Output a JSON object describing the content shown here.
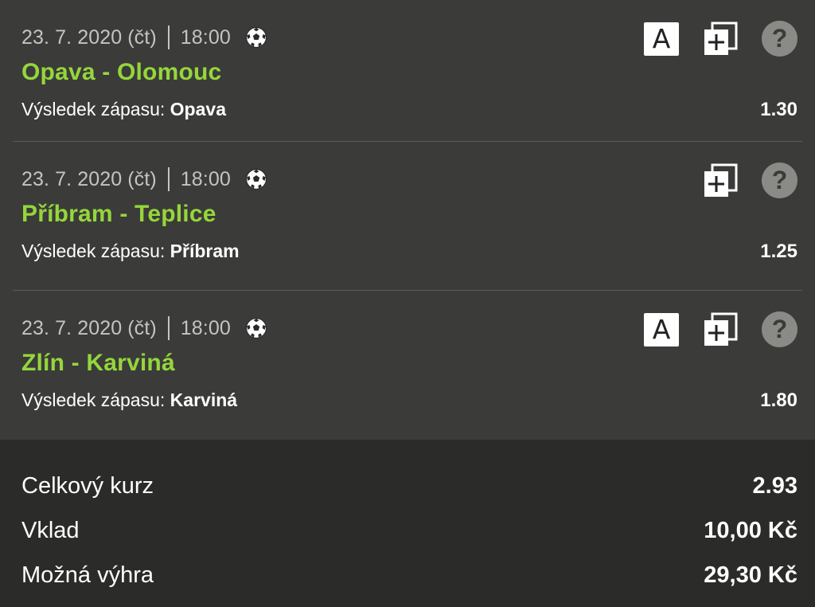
{
  "matches": [
    {
      "date": "23. 7. 2020 (čt)",
      "time": "18:00",
      "sport_icon": "soccer-ball-icon",
      "teams": "Opava - Olomouc",
      "outcome_label": "Výsledek zápasu:",
      "outcome_value": "Opava",
      "odd": "1.30",
      "has_a_button": true,
      "a_label": "A",
      "help_label": "?"
    },
    {
      "date": "23. 7. 2020 (čt)",
      "time": "18:00",
      "sport_icon": "soccer-ball-icon",
      "teams": "Příbram - Teplice",
      "outcome_label": "Výsledek zápasu:",
      "outcome_value": "Příbram",
      "odd": "1.25",
      "has_a_button": false,
      "help_label": "?"
    },
    {
      "date": "23. 7. 2020 (čt)",
      "time": "18:00",
      "sport_icon": "soccer-ball-icon",
      "teams": "Zlín - Karviná",
      "outcome_label": "Výsledek zápasu:",
      "outcome_value": "Karviná",
      "odd": "1.80",
      "has_a_button": true,
      "a_label": "A",
      "help_label": "?"
    }
  ],
  "summary": {
    "total_odds_label": "Celkový kurz",
    "total_odds_value": "2.93",
    "stake_label": "Vklad",
    "stake_value": "10,00 Kč",
    "win_label": "Možná výhra",
    "win_value": "29,30 Kč"
  },
  "colors": {
    "background": "#3b3b39",
    "summary_background": "#2b2b29",
    "teams_green": "#95d63b",
    "meta_grey": "#c4c4c0",
    "help_grey": "#8a8a87"
  }
}
